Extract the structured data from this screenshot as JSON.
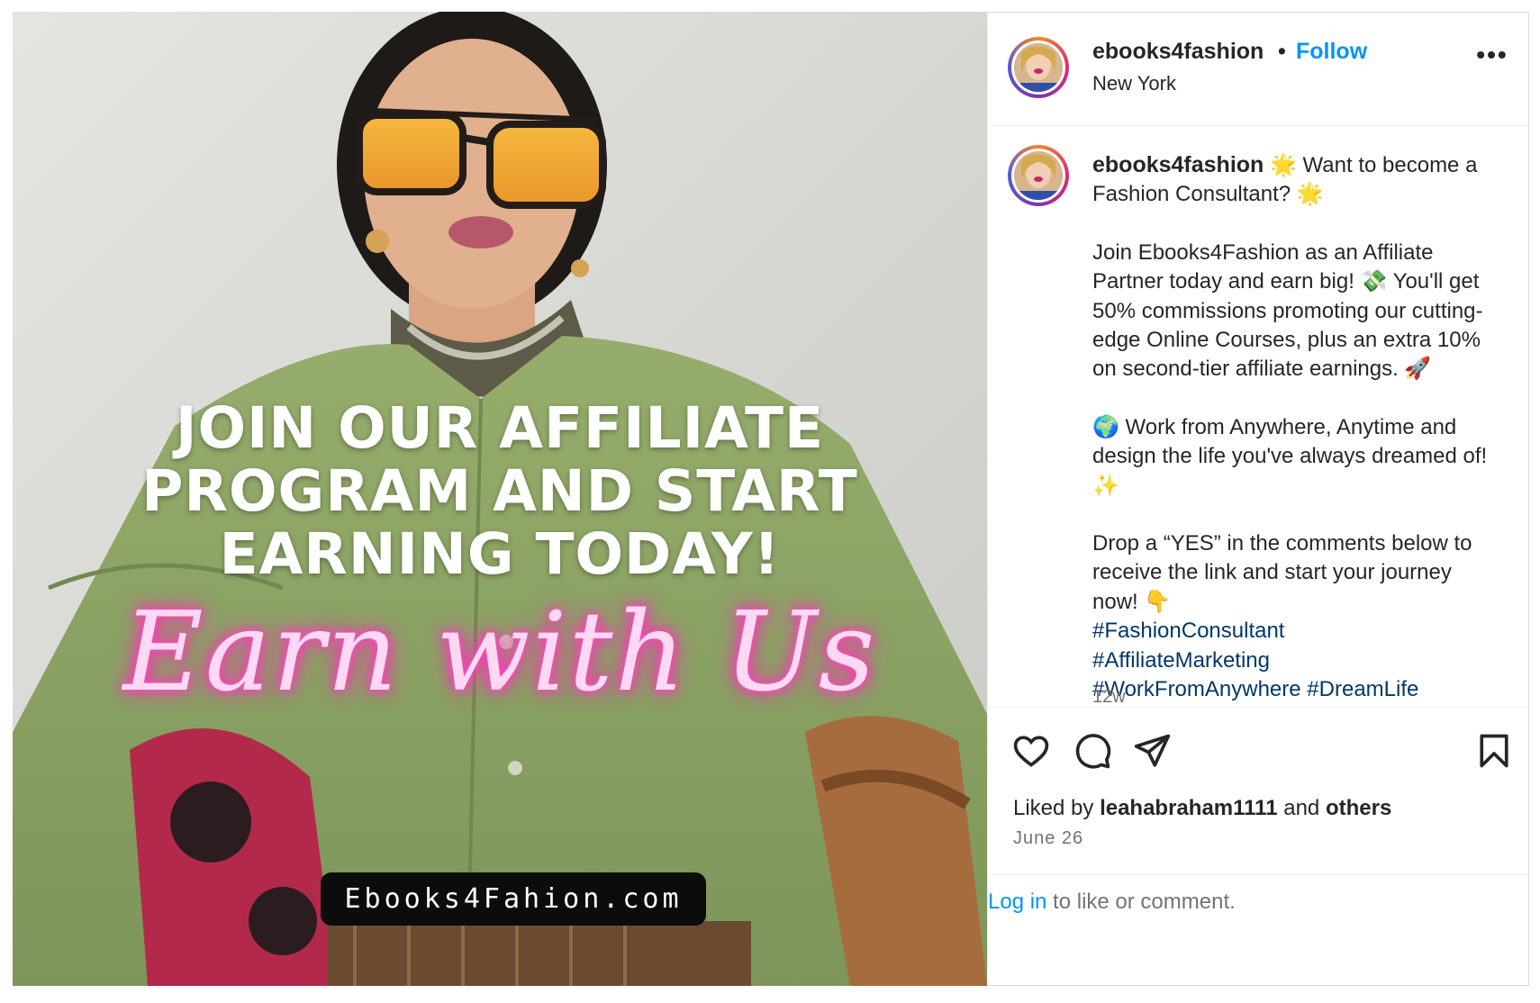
{
  "post_image": {
    "headline_lines": [
      "JOIN OUR AFFILIATE",
      "PROGRAM AND START",
      "EARNING TODAY!"
    ],
    "script_text": "Earn with Us",
    "url_text": "Ebooks4Fahion.com"
  },
  "header": {
    "username": "ebooks4fashion",
    "separator": "•",
    "follow_label": "Follow",
    "location": "New York",
    "more_label": "•••"
  },
  "caption": {
    "username": "ebooks4fashion",
    "line1_rest": " 🌟 Want to become a Fashion Consultant? 🌟",
    "para2": "Join Ebooks4Fashion as an Affiliate Partner today and earn big! 💸 You'll get 50% commissions promoting our cutting-edge Online Courses, plus an extra 10% on second-tier affiliate earnings. 🚀",
    "para3": "🌍 Work from Anywhere, Anytime and design the life you've always dreamed of! ✨",
    "para4": "Drop a “YES” in the comments below to receive the link and start your journey now! 👇",
    "hashtags": [
      "#FashionConsultant",
      "#AffiliateMarketing",
      "#WorkFromAnywhere",
      "#DreamLife"
    ],
    "timestamp": "12w"
  },
  "actions": {
    "liked_by_prefix": "Liked by ",
    "liked_by_user": "leahabraham1111",
    "liked_by_mid": " and ",
    "liked_by_others": "others",
    "date": "June 26",
    "icons": [
      "heart-icon",
      "comment-icon",
      "share-icon",
      "bookmark-icon"
    ]
  },
  "login": {
    "link_label": "Log in",
    "rest": " to like or comment."
  },
  "colors": {
    "follow_blue": "#0095f6",
    "hashtag_blue": "#00376b",
    "neon_pink": "#ff2fb9",
    "shirt_green": "#8da566"
  }
}
